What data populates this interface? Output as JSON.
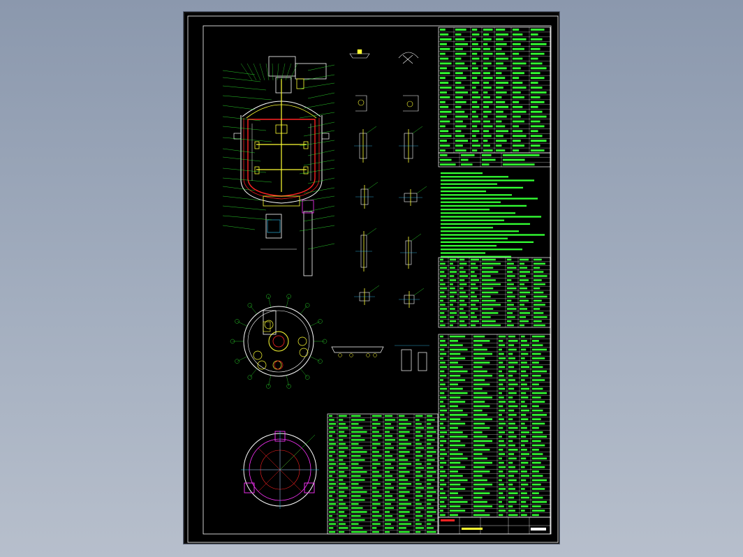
{
  "drawing": {
    "kind": "CAD drawing sheet — jacketed reaction vessel assembly",
    "colors": {
      "background_page": "#9aa5b8",
      "sheet": "#000000",
      "border": "#ffffff",
      "outline": "#ffffff",
      "body_fill": "#ff2222",
      "jacket": "#ffffff",
      "agitator": "#ffff33",
      "leader": "#33ff33",
      "dimension": "#33ccff",
      "flange": "#ff33ff",
      "table_text": "#33ff33",
      "table_grid": "#ffffff"
    },
    "views": [
      "main-elevation",
      "top-plan-nozzles",
      "bottom-plan-legs",
      "detail-set-nozzles",
      "detail-flange-sections"
    ],
    "tables": [
      "technical-characteristics",
      "technical-requirements-text",
      "nozzle-schedule",
      "parts-list-left",
      "parts-list-right",
      "title-block"
    ]
  }
}
